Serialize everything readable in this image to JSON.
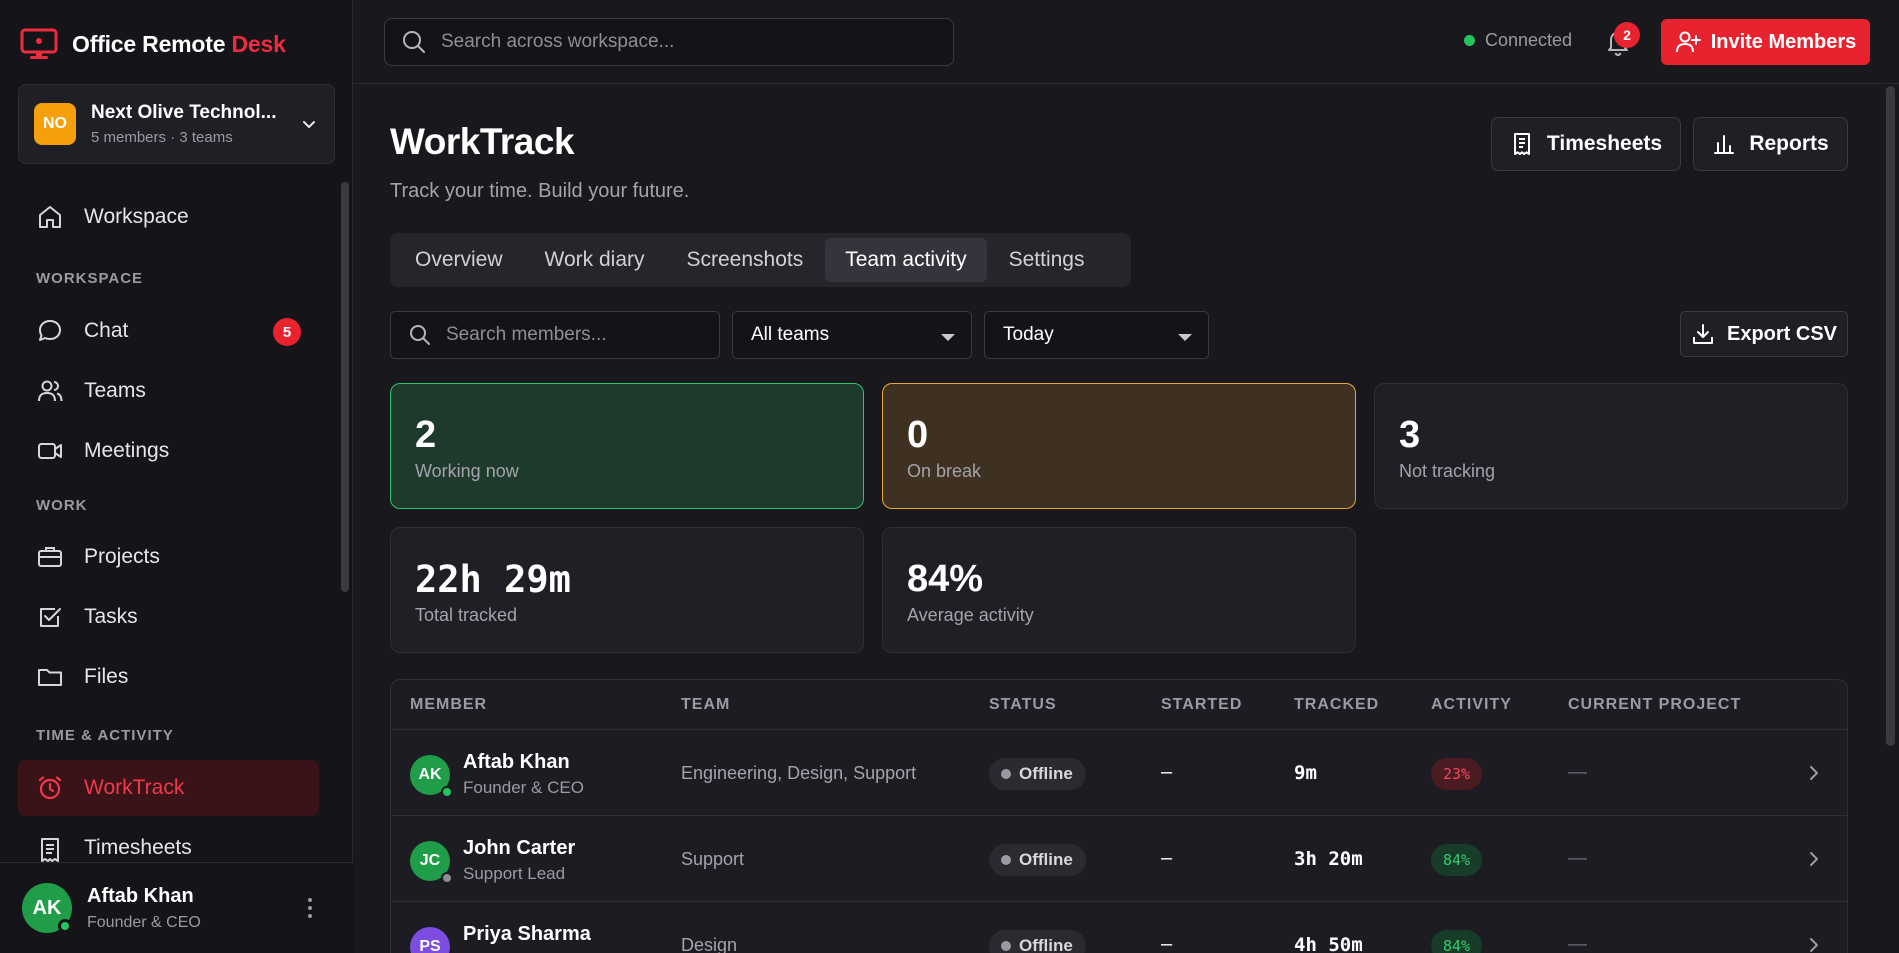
{
  "brand": {
    "name": "Office Remote ",
    "accent": "Desk"
  },
  "org": {
    "initials": "NO",
    "name": "Next Olive Technol...",
    "meta": "5 members · 3 teams"
  },
  "sidebar": {
    "workspace_item": "Workspace",
    "sections": {
      "workspace": "WORKSPACE",
      "work": "WORK",
      "time": "TIME & ACTIVITY"
    },
    "items": {
      "chat": {
        "label": "Chat",
        "badge": "5"
      },
      "teams": {
        "label": "Teams"
      },
      "meetings": {
        "label": "Meetings"
      },
      "projects": {
        "label": "Projects"
      },
      "tasks": {
        "label": "Tasks"
      },
      "files": {
        "label": "Files"
      },
      "worktrack": {
        "label": "WorkTrack"
      },
      "timesheets": {
        "label": "Timesheets"
      }
    }
  },
  "user": {
    "initials": "AK",
    "name": "Aftab Khan",
    "role": "Founder & CEO"
  },
  "topbar": {
    "search_placeholder": "Search across workspace...",
    "connection": "Connected",
    "notifications": "2",
    "invite_label": "Invite Members"
  },
  "page": {
    "title": "WorkTrack",
    "subtitle": "Track your time. Build your future.",
    "timesheets_btn": "Timesheets",
    "reports_btn": "Reports"
  },
  "tabs": [
    "Overview",
    "Work diary",
    "Screenshots",
    "Team activity",
    "Settings"
  ],
  "active_tab": "Team activity",
  "filters": {
    "member_search_placeholder": "Search members...",
    "team_select": "All teams",
    "date_select": "Today",
    "export_label": "Export CSV"
  },
  "stats": {
    "working": {
      "value": "2",
      "label": "Working now"
    },
    "break": {
      "value": "0",
      "label": "On break"
    },
    "not_tracking": {
      "value": "3",
      "label": "Not tracking"
    },
    "total_tracked": {
      "value": "22h 29m",
      "label": "Total tracked"
    },
    "avg_activity": {
      "value": "84%",
      "label": "Average activity"
    }
  },
  "table": {
    "headers": [
      "MEMBER",
      "TEAM",
      "STATUS",
      "STARTED",
      "TRACKED",
      "ACTIVITY",
      "CURRENT PROJECT"
    ],
    "rows": [
      {
        "initials": "AK",
        "name": "Aftab Khan",
        "role": "Founder & CEO",
        "team": "Engineering, Design, Support",
        "status": "Offline",
        "started": "–",
        "tracked": "9m",
        "activity": "23%",
        "project": "—"
      },
      {
        "initials": "JC",
        "name": "John Carter",
        "role": "Support Lead",
        "team": "Support",
        "status": "Offline",
        "started": "–",
        "tracked": "3h 20m",
        "activity": "84%",
        "project": "—"
      },
      {
        "initials": "PS",
        "name": "Priya Sharma",
        "role": "",
        "team": "Design",
        "status": "Offline",
        "started": "–",
        "tracked": "4h 50m",
        "activity": "84%",
        "project": "—"
      }
    ]
  },
  "colors": {
    "accent": "#e8222f",
    "working_border": "#2ec26d",
    "break_border": "#e9a33b",
    "online": "#22c55e"
  }
}
